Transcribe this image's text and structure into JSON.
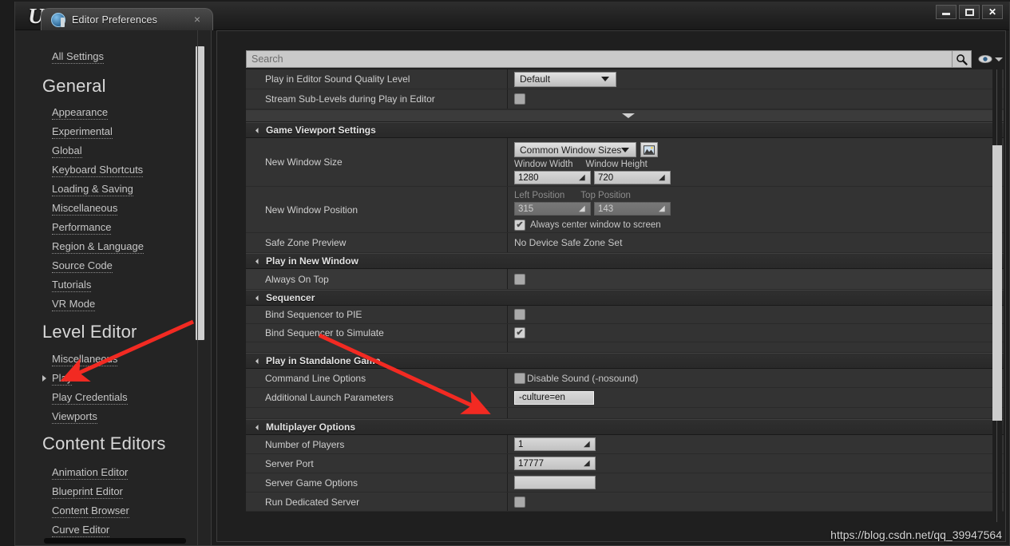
{
  "window": {
    "logo": "unreal-logo",
    "tab_label": "Editor Preferences",
    "tab_close": "×",
    "minimize": "minimize",
    "maximize": "maximize",
    "close": "close"
  },
  "sidebar": {
    "all_settings": "All Settings",
    "groups": [
      {
        "heading": "General",
        "items": [
          "Appearance",
          "Experimental",
          "Global",
          "Keyboard Shortcuts",
          "Loading & Saving",
          "Miscellaneous",
          "Performance",
          "Region & Language",
          "Source Code",
          "Tutorials",
          "VR Mode"
        ]
      },
      {
        "heading": "Level Editor",
        "items": [
          "Miscellaneous",
          "Play",
          "Play Credentials",
          "Viewports"
        ]
      },
      {
        "heading": "Content Editors",
        "items": [
          "Animation Editor",
          "Blueprint Editor",
          "Content Browser",
          "Curve Editor"
        ]
      }
    ],
    "selected_item": "Play"
  },
  "search": {
    "placeholder": "Search",
    "value": "",
    "search_icon": "magnifier-icon",
    "eye_icon": "eye-icon",
    "eye_caret": "chevron-down-icon"
  },
  "properties": {
    "top_rows": [
      {
        "label": "Play in Editor Sound Quality Level",
        "control": "combo",
        "value": "Default"
      },
      {
        "label": "Stream Sub-Levels during Play in Editor",
        "control": "checkbox",
        "checked": false
      }
    ],
    "expand_more": "expand-more",
    "sections": [
      {
        "title": "Game Viewport Settings",
        "rows": [
          {
            "label": "New Window Size",
            "control": "window-size",
            "preset": "Common Window Sizes",
            "width_label": "Window Width",
            "width_value": "1280",
            "height_label": "Window Height",
            "height_value": "720"
          },
          {
            "label": "New Window Position",
            "control": "window-position",
            "left_label": "Left Position",
            "left_value": "315",
            "top_label": "Top Position",
            "top_value": "143",
            "center_label": "Always center window to screen",
            "center_checked": true
          },
          {
            "label": "Safe Zone Preview",
            "control": "static",
            "value": "No Device Safe Zone Set"
          }
        ]
      },
      {
        "title": "Play in New Window",
        "rows": [
          {
            "label": "Always On Top",
            "control": "checkbox",
            "checked": false
          }
        ]
      },
      {
        "title": "Sequencer",
        "rows": [
          {
            "label": "Bind Sequencer to PIE",
            "control": "checkbox",
            "checked": false
          },
          {
            "label": "Bind Sequencer to Simulate",
            "control": "checkbox",
            "checked": true
          }
        ]
      },
      {
        "title": "Play in Standalone Game",
        "rows": [
          {
            "label": "Command Line Options",
            "control": "checkbox-with-text",
            "checked": false,
            "text": "Disable Sound (-nosound)"
          },
          {
            "label": "Additional Launch Parameters",
            "control": "text",
            "value": "-culture=en"
          }
        ]
      },
      {
        "title": "Multiplayer Options",
        "rows": [
          {
            "label": "Number of Players",
            "control": "number",
            "value": "1"
          },
          {
            "label": "Server Port",
            "control": "number",
            "value": "17777"
          },
          {
            "label": "Server Game Options",
            "control": "text",
            "value": ""
          },
          {
            "label": "Run Dedicated Server",
            "control": "checkbox",
            "checked": false
          }
        ]
      }
    ]
  },
  "annotations": {
    "arrow_color": "#f22a22",
    "arrow_1_target": "Play",
    "arrow_2_target": "-culture=en"
  },
  "watermark": "https://blog.csdn.net/qq_39947564"
}
